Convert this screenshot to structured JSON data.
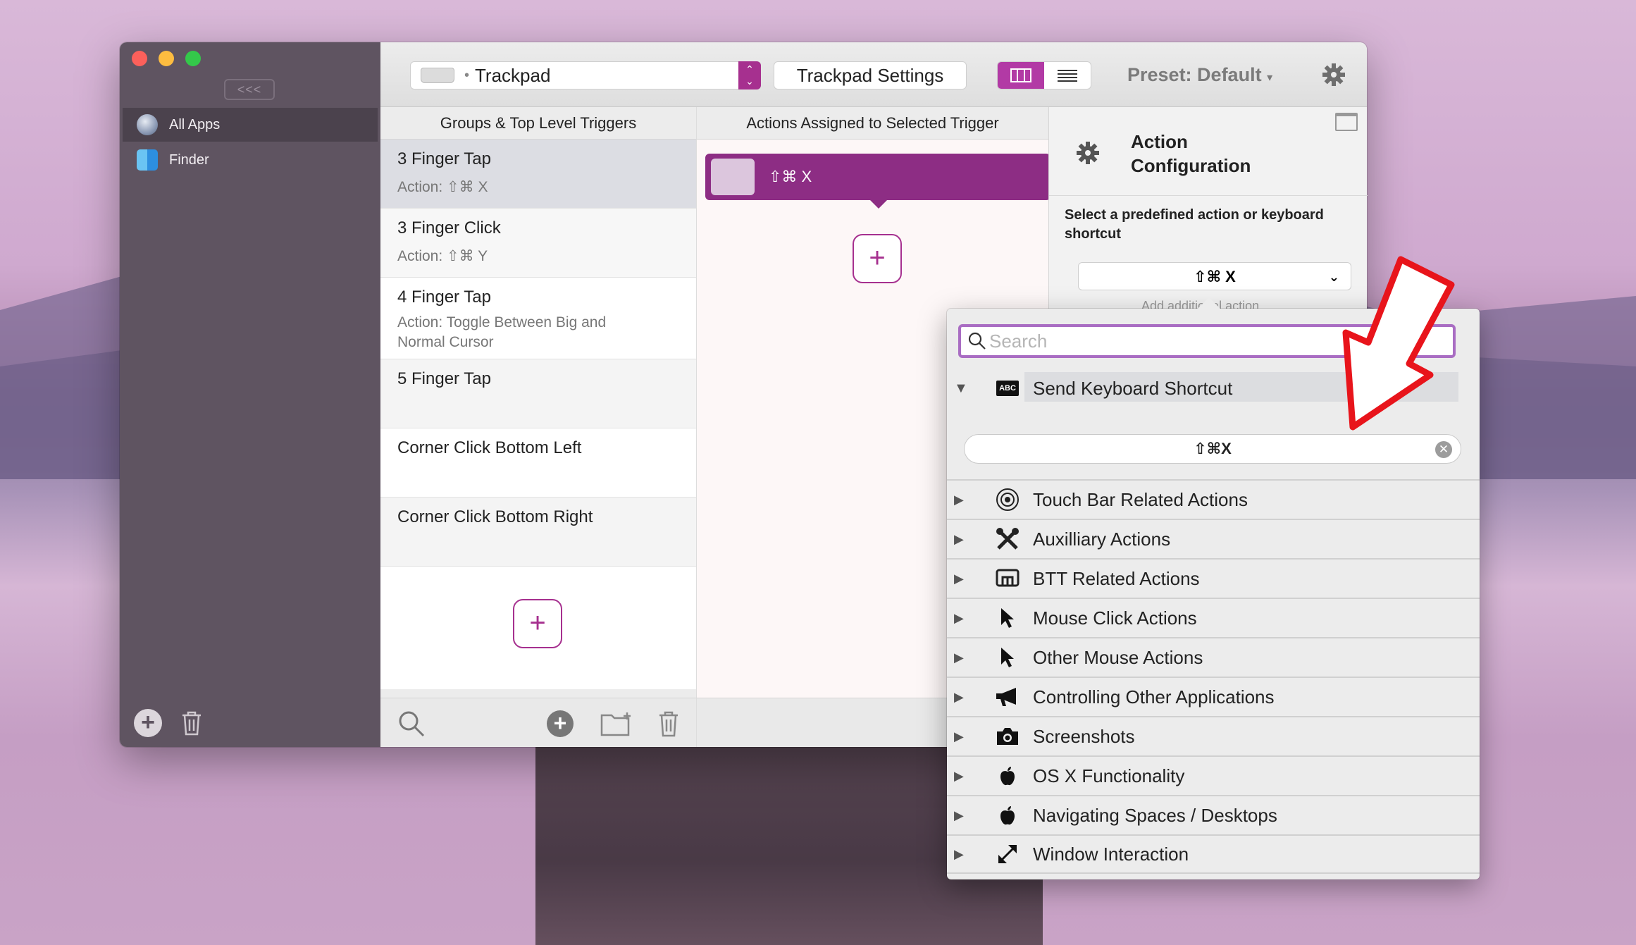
{
  "sidebar": {
    "collapse_label": "<<<",
    "apps": [
      {
        "label": "All Apps",
        "icon": "globe-icon",
        "active": true
      },
      {
        "label": "Finder",
        "icon": "finder-icon",
        "active": false
      }
    ]
  },
  "toolbar": {
    "device_label": "Trackpad",
    "settings_label": "Trackpad Settings",
    "preset_label": "Preset: Default",
    "preset_caret": "▾"
  },
  "columns": {
    "triggers_header": "Groups & Top Level Triggers",
    "actions_header": "Actions Assigned to Selected Trigger"
  },
  "triggers": [
    {
      "title": "3 Finger Tap",
      "sub": "Action: ⇧⌘ X",
      "selected": true
    },
    {
      "title": "3 Finger Click",
      "sub": "Action: ⇧⌘ Y"
    },
    {
      "title": "4 Finger Tap",
      "sub": "Action: Toggle Between Big and Normal Cursor"
    },
    {
      "title": "5 Finger Tap",
      "sub": ""
    },
    {
      "title": "Corner Click Bottom Left",
      "sub": ""
    },
    {
      "title": "Corner Click Bottom Right",
      "sub": ""
    }
  ],
  "add_symbol": "+",
  "actions": {
    "assigned_label": "⇧⌘ X"
  },
  "config": {
    "title_line1": "Action",
    "title_line2": "Configuration",
    "select_label": "Select a predefined action or keyboard shortcut",
    "selected_value": "⇧⌘ X",
    "add_additional": "Add additional action"
  },
  "popup": {
    "search_placeholder": "Search",
    "send_shortcut_label": "Send Keyboard Shortcut",
    "abc_badge": "ABC",
    "shortcut_value": "⇧⌘X",
    "categories": [
      {
        "label": "Touch Bar Related Actions",
        "icon": "touchbar-target-icon"
      },
      {
        "label": "Auxilliary Actions",
        "icon": "tools-icon"
      },
      {
        "label": "BTT Related Actions",
        "icon": "btt-icon"
      },
      {
        "label": "Mouse Click Actions",
        "icon": "mouse-pointer-icon"
      },
      {
        "label": "Other Mouse Actions",
        "icon": "mouse-pointer-icon"
      },
      {
        "label": "Controlling Other Applications",
        "icon": "megaphone-icon"
      },
      {
        "label": "Screenshots",
        "icon": "camera-icon"
      },
      {
        "label": "OS X Functionality",
        "icon": "apple-icon"
      },
      {
        "label": "Navigating Spaces / Desktops",
        "icon": "apple-icon"
      },
      {
        "label": "Window Interaction",
        "icon": "resize-arrows-icon"
      }
    ]
  },
  "colors": {
    "accent": "#a6308f",
    "action_pill": "#8d2d84",
    "annotation_arrow": "#e8141b"
  }
}
